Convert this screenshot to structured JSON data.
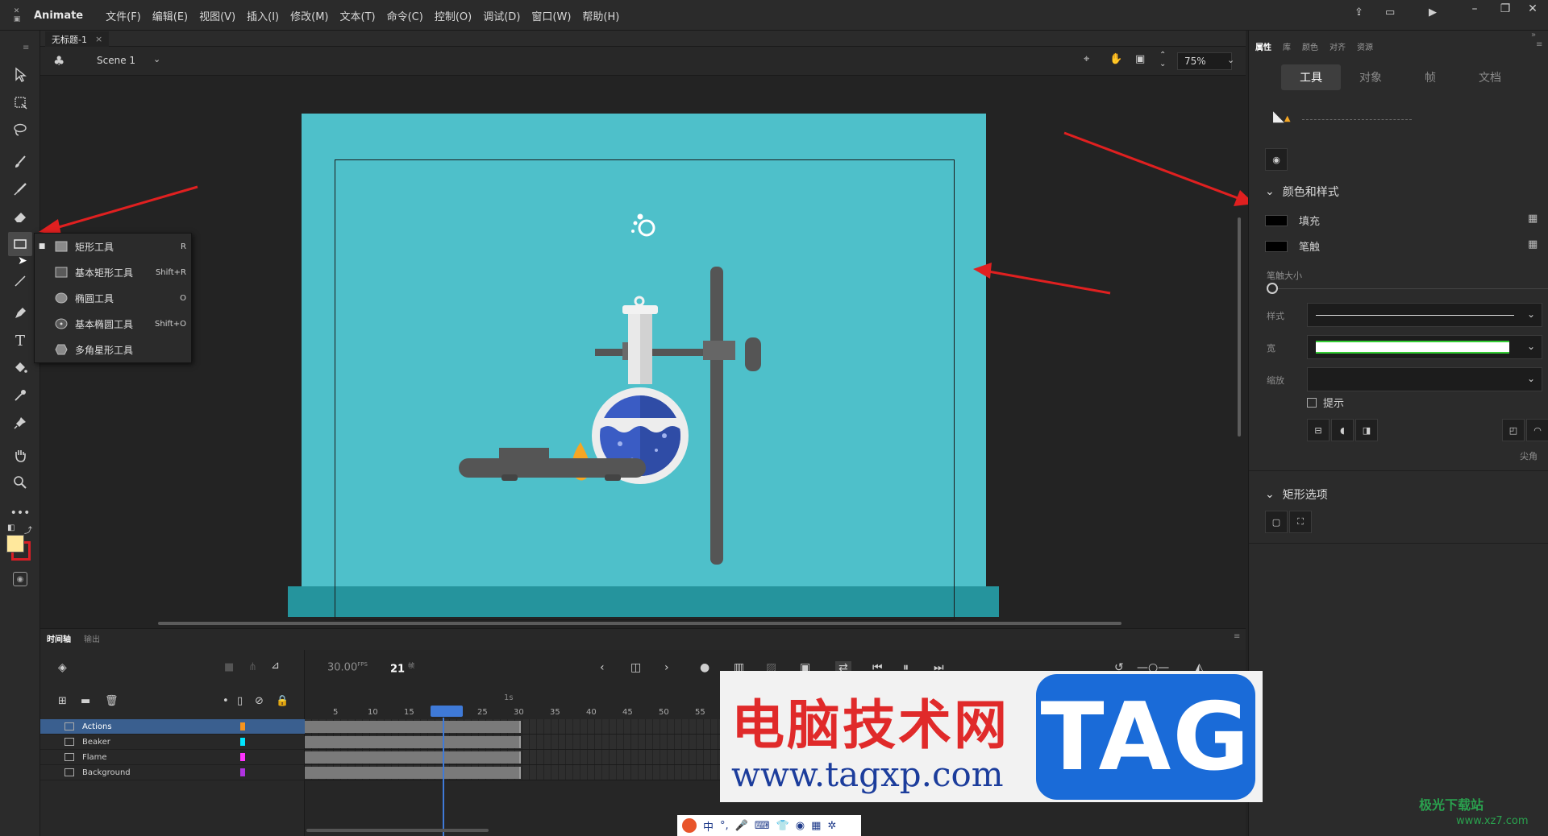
{
  "app": {
    "name": "Animate"
  },
  "menu": [
    "文件(F)",
    "编辑(E)",
    "视图(V)",
    "插入(I)",
    "修改(M)",
    "文本(T)",
    "命令(C)",
    "控制(O)",
    "调试(D)",
    "窗口(W)",
    "帮助(H)"
  ],
  "document": {
    "tab_title": "无标题-1",
    "tab_close": "×",
    "scene": "Scene 1",
    "zoom": "75%"
  },
  "shape_menu": {
    "items": [
      {
        "label": "矩形工具",
        "shortcut": "R",
        "selected": true
      },
      {
        "label": "基本矩形工具",
        "shortcut": "Shift+R"
      },
      {
        "label": "椭圆工具",
        "shortcut": "O"
      },
      {
        "label": "基本椭圆工具",
        "shortcut": "Shift+O"
      },
      {
        "label": "多角星形工具",
        "shortcut": ""
      }
    ]
  },
  "properties": {
    "panel_tabs": [
      "属性",
      "库",
      "颜色",
      "对齐",
      "资源"
    ],
    "subtabs": [
      "工具",
      "对象",
      "帧",
      "文档"
    ],
    "color_section": "颜色和样式",
    "fill_label": "填充",
    "stroke_label": "笔触",
    "stroke_size_label": "笔触大小",
    "style_label": "样式",
    "width_label": "宽",
    "scale_label": "缩放",
    "hint_label": "提示",
    "corner_label": "尖角",
    "rect_section": "矩形选项"
  },
  "timeline": {
    "tabs": [
      "时间轴",
      "输出"
    ],
    "fps": "30.00",
    "fps_unit": "FPS",
    "frame": "21",
    "frame_unit": "帧",
    "ruler_marker": "1s",
    "ruler": [
      "5",
      "10",
      "15",
      "20",
      "25",
      "30",
      "35",
      "40",
      "45",
      "50",
      "55"
    ],
    "layers": [
      {
        "name": "Actions",
        "color": "#f7941d",
        "selected": true
      },
      {
        "name": "Beaker",
        "color": "#00e5ff"
      },
      {
        "name": "Flame",
        "color": "#ff33ff"
      },
      {
        "name": "Background",
        "color": "#b033e0"
      }
    ]
  },
  "colors": {
    "stage": "#4ec0ca",
    "accent": "#3f7ad8",
    "arrow": "#e02020"
  },
  "watermark": {
    "cn": "电脑技术网",
    "url": "www.tagxp.com",
    "tag": "TAG"
  },
  "ime": {
    "label": "中"
  },
  "corner": {
    "logo": "极光下载站",
    "url": "www.xz7.com"
  }
}
